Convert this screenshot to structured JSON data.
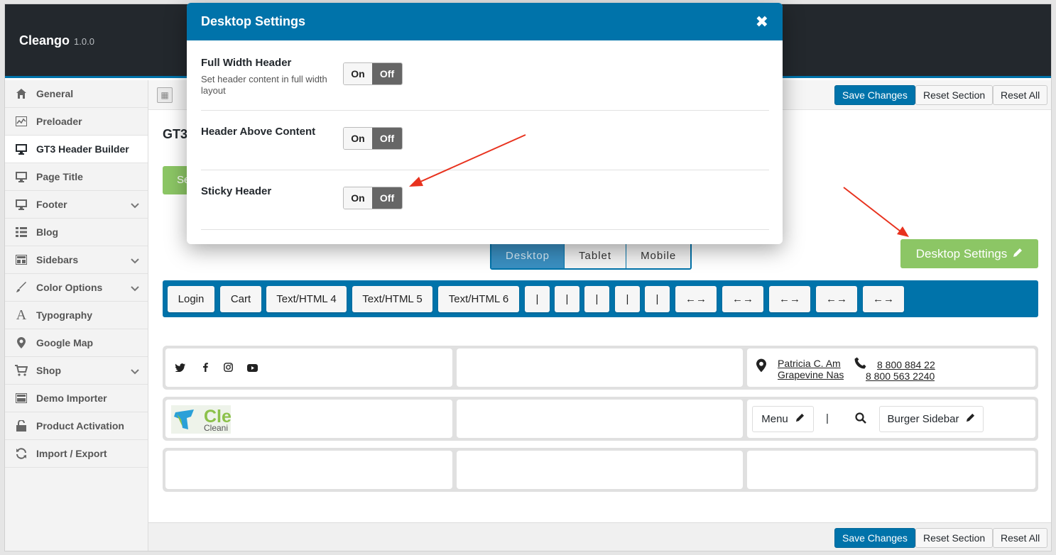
{
  "app": {
    "name": "Cleango",
    "version": "1.0.0"
  },
  "colors": {
    "accent": "#0073aa",
    "green": "#8cc665",
    "dark": "#23282d",
    "arrow": "#e8321e"
  },
  "sidebar": {
    "items": [
      {
        "label": "General",
        "icon": "home-icon"
      },
      {
        "label": "Preloader",
        "icon": "chart-icon"
      },
      {
        "label": "GT3 Header Builder",
        "icon": "desktop-icon",
        "active": true
      },
      {
        "label": "Page Title",
        "icon": "desktop-icon"
      },
      {
        "label": "Footer",
        "icon": "desktop-icon",
        "expandable": true
      },
      {
        "label": "Blog",
        "icon": "list-icon"
      },
      {
        "label": "Sidebars",
        "icon": "layout-icon",
        "expandable": true
      },
      {
        "label": "Color Options",
        "icon": "brush-icon",
        "expandable": true
      },
      {
        "label": "Typography",
        "icon": "font-icon"
      },
      {
        "label": "Google Map",
        "icon": "map-pin-icon"
      },
      {
        "label": "Shop",
        "icon": "cart-icon",
        "expandable": true
      },
      {
        "label": "Demo Importer",
        "icon": "layout-icon"
      },
      {
        "label": "Product Activation",
        "icon": "unlock-icon"
      },
      {
        "label": "Import / Export",
        "icon": "refresh-icon"
      }
    ]
  },
  "toolbar": {
    "save": "Save Changes",
    "reset_section": "Reset Section",
    "reset_all": "Reset All"
  },
  "section": {
    "title": "GT3",
    "left_button": "Se"
  },
  "device_tabs": [
    "Desktop",
    "Tablet",
    "Mobile"
  ],
  "desktop_settings_button": "Desktop Settings",
  "palette": [
    "Login",
    "Cart",
    "Text/HTML 4",
    "Text/HTML 5",
    "Text/HTML 6",
    "|",
    "|",
    "|",
    "|",
    "|",
    "←→",
    "←→",
    "←→",
    "←→",
    "←→"
  ],
  "rows": {
    "top": {
      "social": [
        "twitter-icon",
        "facebook-icon",
        "instagram-icon",
        "youtube-icon"
      ],
      "address_line1": "Patricia C. Am",
      "address_line2": "Grapevine Nas",
      "phone1": "8 800 884 22",
      "phone2": "8 800 563 2240"
    },
    "middle": {
      "logo_text": "Cle",
      "logo_sub": "Cleani",
      "menu": "Menu",
      "divider": "|",
      "burger": "Burger Sidebar"
    }
  },
  "modal": {
    "title": "Desktop Settings",
    "settings": [
      {
        "label": "Full Width Header",
        "desc": "Set header content in full width layout",
        "on": "On",
        "off": "Off"
      },
      {
        "label": "Header Above Content",
        "desc": "",
        "on": "On",
        "off": "Off"
      },
      {
        "label": "Sticky Header",
        "desc": "",
        "on": "On",
        "off": "Off"
      }
    ]
  }
}
